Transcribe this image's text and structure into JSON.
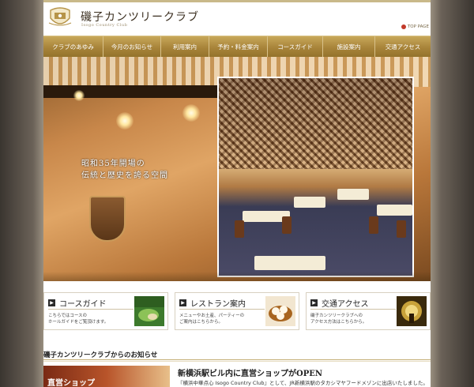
{
  "header": {
    "site_title": "磯子カンツリークラブ",
    "site_subtitle": "Isogo Country Club",
    "top_page_link": "TOP PAGE"
  },
  "nav": {
    "items": [
      {
        "label": "クラブのあゆみ"
      },
      {
        "label": "今月のお知らせ"
      },
      {
        "label": "利用案内"
      },
      {
        "label": "予約・料金案内"
      },
      {
        "label": "コースガイド"
      },
      {
        "label": "施設案内"
      },
      {
        "label": "交通アクセス"
      }
    ]
  },
  "hero": {
    "caption_line1": "昭和35年開場の",
    "caption_line2": "伝統と歴史を誇る空間"
  },
  "features": [
    {
      "title": "コースガイド",
      "desc": "こちらではコースの\nホールガイドをご覧頂けます。",
      "icon": "golf-course-thumbnail"
    },
    {
      "title": "レストラン案内",
      "desc": "メニューやお土産、パーティーの\nご案内はこちらから。",
      "icon": "dumpling-thumbnail"
    },
    {
      "title": "交通アクセス",
      "desc": "磯子カンツリークラブへの\nアクセス方法はこちらから。",
      "icon": "station-thumbnail"
    }
  ],
  "news": {
    "heading": "磯子カンツリークラブからのお知らせ",
    "thumb_label": "直営ショップ",
    "item_title": "新横浜駅ビル内に直営ショップがOPEN",
    "item_body": "『横浜中華点心 Isogo Country Club』として、JR新横浜駅のタカシマヤフードメゾンに出店いたしました。"
  },
  "colors": {
    "nav_gold": "#a8843a",
    "accent_red": "#c23a2a",
    "side_bg": "#6b6258"
  }
}
